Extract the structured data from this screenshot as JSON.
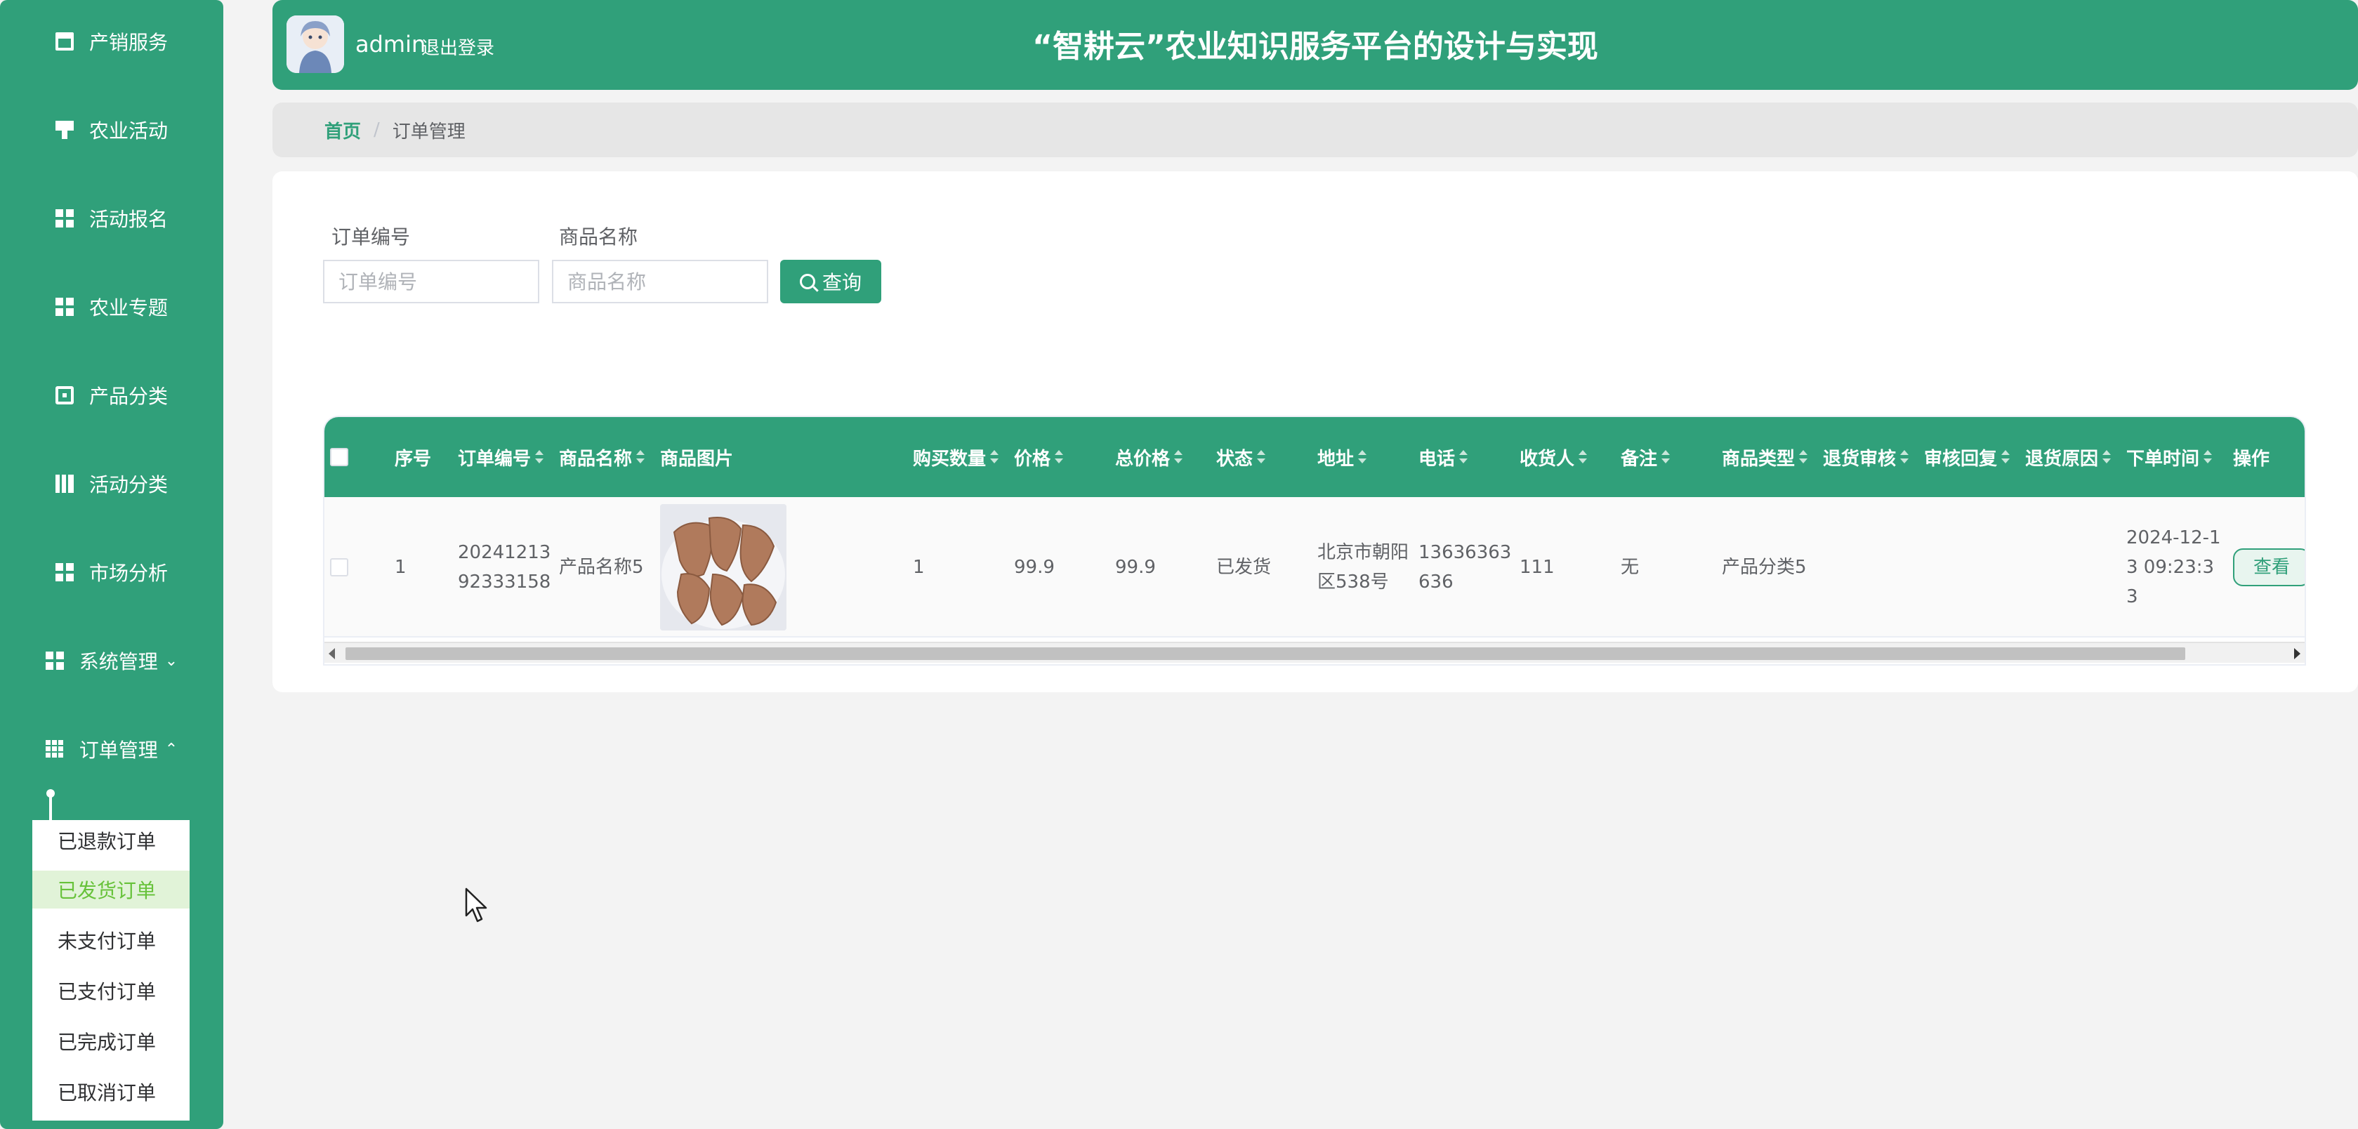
{
  "sidebar": {
    "items": [
      {
        "label": "产销服务",
        "icon": "briefcase-icon"
      },
      {
        "label": "农业活动",
        "icon": "flag-icon"
      },
      {
        "label": "活动报名",
        "icon": "grid-icon"
      },
      {
        "label": "农业专题",
        "icon": "grid-icon"
      },
      {
        "label": "产品分类",
        "icon": "clipboard-icon"
      },
      {
        "label": "活动分类",
        "icon": "book-icon"
      },
      {
        "label": "市场分析",
        "icon": "grid-icon"
      },
      {
        "label": "系统管理",
        "icon": "grid-icon",
        "chevron": "⌄"
      },
      {
        "label": "订单管理",
        "icon": "grid9-icon",
        "chevron": "⌃"
      }
    ],
    "submenu": [
      {
        "label": "已退款订单"
      },
      {
        "label": "已发货订单",
        "active": true
      },
      {
        "label": "未支付订单"
      },
      {
        "label": "已支付订单"
      },
      {
        "label": "已完成订单"
      },
      {
        "label": "已取消订单"
      }
    ]
  },
  "header": {
    "admin_name": "admin",
    "logout": "退出登录",
    "title": "“智耕云”农业知识服务平台的设计与实现"
  },
  "breadcrumb": {
    "home": "首页",
    "separator": "/",
    "current": "订单管理"
  },
  "search": {
    "order_no_label": "订单编号",
    "order_no_placeholder": "订单编号",
    "product_name_label": "商品名称",
    "product_name_placeholder": "商品名称",
    "button": "查询"
  },
  "table": {
    "headers": {
      "index": "序号",
      "order_no": "订单编号",
      "product_name": "商品名称",
      "product_image": "商品图片",
      "quantity": "购买数量",
      "price": "价格",
      "total": "总价格",
      "status": "状态",
      "address": "地址",
      "phone": "电话",
      "receiver": "收货人",
      "remark": "备注",
      "product_type": "商品类型",
      "refund_review": "退货审核",
      "review_reply": "审核回复",
      "refund_reason": "退货原因",
      "order_time": "下单时间",
      "actions": "操作"
    },
    "rows": [
      {
        "index": "1",
        "order_no": "2024121392333158",
        "product_name": "产品名称5",
        "quantity": "1",
        "price": "99.9",
        "total": "99.9",
        "status": "已发货",
        "address": "北京市朝阳区538号",
        "phone": "13636363636",
        "receiver": "111",
        "remark": "无",
        "product_type": "产品分类5",
        "refund_review": "",
        "review_reply": "",
        "refund_reason": "",
        "order_time": "2024-12-13 09:23:33",
        "action_view": "查看"
      }
    ]
  },
  "colors": {
    "primary": "#30a07a",
    "active_bg": "#e1f3d8",
    "active_text": "#67c23a"
  }
}
